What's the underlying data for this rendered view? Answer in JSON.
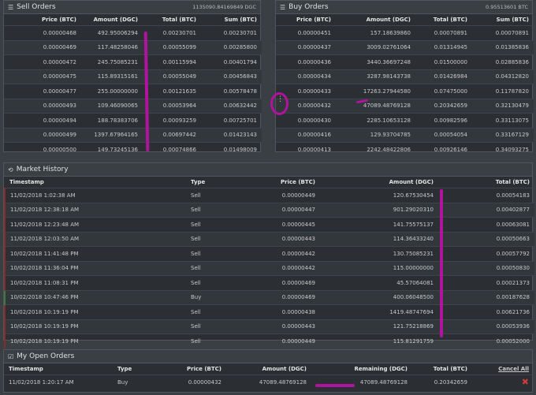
{
  "sell_orders": {
    "title": "Sell Orders",
    "total": "1135090.84169849 DGC",
    "columns": [
      "Price (BTC)",
      "Amount (DGC)",
      "Total (BTC)",
      "Sum (BTC)"
    ],
    "rows": [
      [
        "0.00000468",
        "492.95006294",
        "0.00230701",
        "0.00230701"
      ],
      [
        "0.00000469",
        "117.48258046",
        "0.00055099",
        "0.00285800"
      ],
      [
        "0.00000472",
        "245.75085231",
        "0.00115994",
        "0.00401794"
      ],
      [
        "0.00000475",
        "115.89315161",
        "0.00055049",
        "0.00456843"
      ],
      [
        "0.00000477",
        "255.00000000",
        "0.00121635",
        "0.00578478"
      ],
      [
        "0.00000493",
        "109.46090065",
        "0.00053964",
        "0.00632442"
      ],
      [
        "0.00000494",
        "188.78383706",
        "0.00093259",
        "0.00725701"
      ],
      [
        "0.00000499",
        "1397.67964165",
        "0.00697442",
        "0.01423143"
      ],
      [
        "0.00000500",
        "149.73245136",
        "0.00074866",
        "0.01498009"
      ]
    ]
  },
  "buy_orders": {
    "title": "Buy Orders",
    "total": "0.95513601 BTC",
    "columns": [
      "Price (BTC)",
      "Amount (DGC)",
      "Total (BTC)",
      "Sum (BTC)"
    ],
    "rows": [
      [
        "0.00000451",
        "157.18639860",
        "0.00070891",
        "0.00070891"
      ],
      [
        "0.00000437",
        "3009.02761064",
        "0.01314945",
        "0.01385836"
      ],
      [
        "0.00000436",
        "3440.36697248",
        "0.01500000",
        "0.02885836"
      ],
      [
        "0.00000434",
        "3287.98143738",
        "0.01426984",
        "0.04312820"
      ],
      [
        "0.00000433",
        "17263.27944580",
        "0.07475000",
        "0.11787820"
      ],
      [
        "0.00000432",
        "47089.48769128",
        "0.20342659",
        "0.32130479"
      ],
      [
        "0.00000430",
        "2285.10653128",
        "0.00982596",
        "0.33113075"
      ],
      [
        "0.00000416",
        "129.93704785",
        "0.00054054",
        "0.33167129"
      ],
      [
        "0.00000413",
        "2242.48422806",
        "0.00926146",
        "0.34093275"
      ]
    ]
  },
  "market_history": {
    "title": "Market History",
    "columns": [
      "Timestamp",
      "Type",
      "Price (BTC)",
      "Amount (DGC)",
      "Total (BTC)"
    ],
    "rows": [
      [
        "11/02/2018 1:02:38 AM",
        "Sell",
        "0.00000449",
        "120.67530454",
        "0.00054183"
      ],
      [
        "11/02/2018 12:38:18 AM",
        "Sell",
        "0.00000447",
        "901.29020310",
        "0.00402877"
      ],
      [
        "11/02/2018 12:23:48 AM",
        "Sell",
        "0.00000445",
        "141.75575137",
        "0.00063081"
      ],
      [
        "11/02/2018 12:03:50 AM",
        "Sell",
        "0.00000443",
        "114.36433240",
        "0.00050663"
      ],
      [
        "10/02/2018 11:41:48 PM",
        "Sell",
        "0.00000442",
        "130.75085231",
        "0.00057792"
      ],
      [
        "10/02/2018 11:36:04 PM",
        "Sell",
        "0.00000442",
        "115.00000000",
        "0.00050830"
      ],
      [
        "10/02/2018 11:08:31 PM",
        "Sell",
        "0.00000469",
        "45.57064081",
        "0.00021373"
      ],
      [
        "10/02/2018 10:47:46 PM",
        "Buy",
        "0.00000469",
        "400.06048500",
        "0.00187628"
      ],
      [
        "10/02/2018 10:19:19 PM",
        "Sell",
        "0.00000438",
        "1419.48747694",
        "0.00621736"
      ],
      [
        "10/02/2018 10:19:19 PM",
        "Sell",
        "0.00000443",
        "121.75218869",
        "0.00053936"
      ],
      [
        "10/02/2018 10:19:19 PM",
        "Sell",
        "0.00000449",
        "115.81291759",
        "0.00052000"
      ]
    ]
  },
  "open_orders": {
    "title": "My Open Orders",
    "columns": [
      "Timestamp",
      "Type",
      "Price (BTC)",
      "Amount (DGC)",
      "Remaining (DGC)",
      "Total (BTC)"
    ],
    "cancel_all": "Cancel All",
    "rows": [
      [
        "11/02/2018 1:20:17 AM",
        "Buy",
        "0.00000432",
        "47089.48769128",
        "47089.48769128",
        "0.20342659"
      ]
    ]
  },
  "colors": {
    "annotation": "#b0139e",
    "sell_marker": "#8a2a2a",
    "buy_marker": "#3d7a3d"
  },
  "icons": [
    "list-icon",
    "history-icon",
    "check-icon",
    "sort-icon",
    "delete-icon"
  ]
}
